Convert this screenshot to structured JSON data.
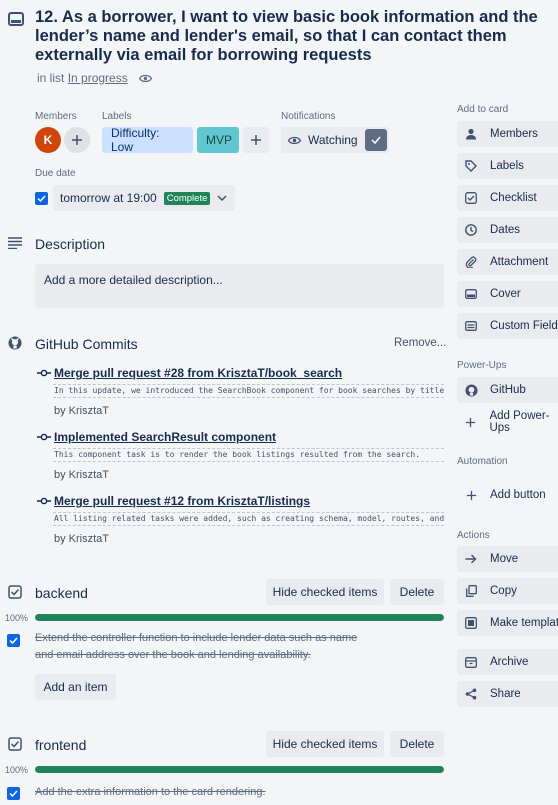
{
  "card": {
    "title": "12. As a borrower, I want to view basic book information and the lender’s name and lender's email, so that I can contact them externally via email for borrowing requests",
    "list_prefix": "in list",
    "list_name": "In progress"
  },
  "members": {
    "label": "Members",
    "avatar_initial": "K"
  },
  "labels": {
    "label": "Labels",
    "items": [
      {
        "text": "Difficulty: Low",
        "color": "#cce0ff"
      },
      {
        "text": "MVP",
        "color": "#60c6d2"
      }
    ]
  },
  "notifications": {
    "label": "Notifications",
    "button": "Watching"
  },
  "due_date": {
    "label": "Due date",
    "value": "tomorrow at 19:00",
    "badge": "Complete",
    "badge_color": "#1f845a"
  },
  "description": {
    "heading": "Description",
    "placeholder": "Add a more detailed description..."
  },
  "github": {
    "heading": "GitHub Commits",
    "remove_label": "Remove...",
    "commits": [
      {
        "title": "Merge pull request #28 from KrisztaT/book_search",
        "body": "In this update, we introduced the SearchBook component for book searches by title or author. And integrated it",
        "author": "by KrisztaT"
      },
      {
        "title": "Implemented SearchResult component",
        "body": "This component task is to render the book listings resulted from the search.",
        "author": "by KrisztaT"
      },
      {
        "title": "Merge pull request #12 from KrisztaT/listings",
        "body": "All listing related tasks were added, such as creating schema, model, routes, and controller functions.",
        "author": "by KrisztaT"
      }
    ]
  },
  "checklists": [
    {
      "title": "backend",
      "hide_label": "Hide checked items",
      "delete_label": "Delete",
      "percent_text": "100%",
      "progress": 1.0,
      "items": [
        "Extend the controller function to include lender data such as name and email address over the book and lending availability."
      ],
      "add_label": "Add an item"
    },
    {
      "title": "frontend",
      "hide_label": "Hide checked items",
      "delete_label": "Delete",
      "percent_text": "100%",
      "progress": 1.0,
      "items": [
        "Add the extra information to the card rendering."
      ]
    }
  ],
  "sidebar": {
    "add_to_card": "Add to card",
    "add_items": [
      {
        "label": "Members",
        "icon": "person-icon"
      },
      {
        "label": "Labels",
        "icon": "tag-icon"
      },
      {
        "label": "Checklist",
        "icon": "checklist-icon"
      },
      {
        "label": "Dates",
        "icon": "clock-icon"
      },
      {
        "label": "Attachment",
        "icon": "paperclip-icon"
      },
      {
        "label": "Cover",
        "icon": "cover-icon"
      },
      {
        "label": "Custom Fields",
        "icon": "custom-fields-icon"
      }
    ],
    "powerups_heading": "Power-Ups",
    "github_label": "GitHub",
    "add_powerup_label": "Add Power-Ups",
    "automation_heading": "Automation",
    "add_button_label": "Add button",
    "actions_heading": "Actions",
    "actions": [
      {
        "label": "Move",
        "icon": "arrow-right-icon"
      },
      {
        "label": "Copy",
        "icon": "copy-icon"
      },
      {
        "label": "Make template",
        "icon": "template-icon"
      },
      {
        "label": "Archive",
        "icon": "archive-icon"
      },
      {
        "label": "Share",
        "icon": "share-icon"
      }
    ]
  }
}
